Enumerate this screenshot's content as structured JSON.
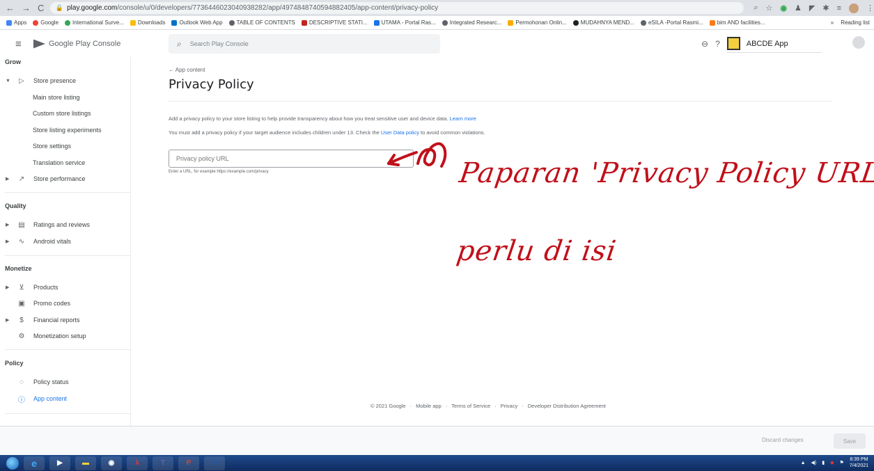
{
  "browser": {
    "url_host": "play.google.com",
    "url_path": "/console/u/0/developers/7736446023040938282/app/4974848740594882405/app-content/privacy-policy",
    "bookmarks": [
      "Apps",
      "Google",
      "International Surve...",
      "Downloads",
      "Outlook Web App",
      "TABLE OF CONTENTS",
      "DESCRIPTIVE STATI...",
      "UTAMA - Portal Ras...",
      "Integrated Researc...",
      "Permohonan Onlin...",
      "MUDAHNYA MEND...",
      "eSILA -Portal Rasmi...",
      "bim AND facilities..."
    ],
    "reading_list": "Reading list"
  },
  "header": {
    "logo_text": "Google Play Console",
    "search_placeholder": "Search Play Console",
    "app_name": "ABCDE App"
  },
  "sidebar": {
    "grow": "Grow",
    "store_presence": "Store presence",
    "main_store_listing": "Main store listing",
    "custom_store_listings": "Custom store listings",
    "store_listing_experiments": "Store listing experiments",
    "store_settings": "Store settings",
    "translation_service": "Translation service",
    "store_performance": "Store performance",
    "quality": "Quality",
    "ratings_reviews": "Ratings and reviews",
    "android_vitals": "Android vitals",
    "monetize": "Monetize",
    "products": "Products",
    "promo_codes": "Promo codes",
    "financial_reports": "Financial reports",
    "monetization_setup": "Monetization setup",
    "policy": "Policy",
    "policy_status": "Policy status",
    "app_content": "App content"
  },
  "main": {
    "back_link": "← App content",
    "title": "Privacy Policy",
    "desc1": "Add a privacy policy to your store listing to help provide transparency about how you treat sensitive user and device data.",
    "desc1_link": "Learn more",
    "desc2_pre": "You must add a privacy policy if your target audience includes children under 13. Check the",
    "desc2_link": "User Data policy",
    "desc2_post": "to avoid common violations.",
    "input_placeholder": "Privacy policy URL",
    "helper": "Enter a URL, for example https://example.com/privacy"
  },
  "annotation": {
    "line1": "Paparan 'Privacy Policy URL'",
    "line2": "perlu di isi"
  },
  "footer": {
    "copyright": "© 2021 Google",
    "mobile_app": "Mobile app",
    "terms": "Terms of Service",
    "privacy": "Privacy",
    "dda": "Developer Distribution Agreement"
  },
  "actions": {
    "discard": "Discard changes",
    "save": "Save"
  },
  "taskbar": {
    "time": "8:39 PM",
    "date": "7/4/2021"
  }
}
